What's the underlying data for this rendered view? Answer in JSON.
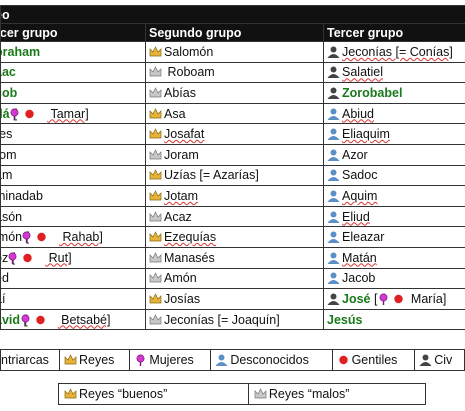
{
  "table": {
    "title": "eo",
    "headers": [
      "rcer grupo",
      "Segundo grupo",
      "Tercer grupo"
    ],
    "rows": [
      [
        {
          "t": "oraham",
          "k": "green"
        },
        {
          "t": "Salomón",
          "i": "crown-gold"
        },
        {
          "t": "Jeconías [= Conías]",
          "i": "person-dark",
          "u": true
        }
      ],
      [
        {
          "t": "aac",
          "k": "green"
        },
        {
          "t": " Roboam",
          "i": "crown-gray"
        },
        {
          "t": "Salatiel",
          "i": "person-dark",
          "u": true
        }
      ],
      [
        {
          "t": "cob",
          "k": "green"
        },
        {
          "t": "Abías",
          "i": "crown-gray"
        },
        {
          "t": "Zorobabel",
          "i": "person-dark",
          "k": "green"
        }
      ],
      [
        {
          "t": "dá [",
          "k": "green",
          "extra": " Tamar]"
        },
        {
          "t": "Asa",
          "i": "crown-gold"
        },
        {
          "t": "Abiud",
          "i": "person-blue",
          "u": true
        }
      ],
      [
        {
          "t": "res"
        },
        {
          "t": "Josafat",
          "i": "crown-gold",
          "u": true
        },
        {
          "t": "Eliaquim",
          "i": "person-blue",
          "u": true
        }
      ],
      [
        {
          "t": "rom"
        },
        {
          "t": "Joram",
          "i": "crown-gray"
        },
        {
          "t": "Azor",
          "i": "person-blue"
        }
      ],
      [
        {
          "t": "am"
        },
        {
          "t": "Uzías [= Azarías]",
          "i": "crown-gold"
        },
        {
          "t": "Sadoc",
          "i": "person-blue"
        }
      ],
      [
        {
          "t": "minadab"
        },
        {
          "t": "Jotam",
          "i": "crown-gold",
          "u": true
        },
        {
          "t": "Aquim",
          "i": "person-blue",
          "u": true
        }
      ],
      [
        {
          "t": "asón"
        },
        {
          "t": "Acaz",
          "i": "crown-gray"
        },
        {
          "t": "Eliud",
          "i": "person-blue",
          "u": true
        }
      ],
      [
        {
          "t": "lmón [",
          "extra": " Rahab]"
        },
        {
          "t": "Ezequías",
          "i": "crown-gold",
          "u": true
        },
        {
          "t": "Eleazar",
          "i": "person-blue"
        }
      ],
      [
        {
          "t": "oz [",
          "extra": " Rut]"
        },
        {
          "t": "Manasés",
          "i": "crown-gray"
        },
        {
          "t": "Matán",
          "i": "person-blue",
          "u": true
        }
      ],
      [
        {
          "t": "ed"
        },
        {
          "t": "Amón",
          "i": "crown-gray"
        },
        {
          "t": "Jacob",
          "i": "person-blue"
        }
      ],
      [
        {
          "t": "aí"
        },
        {
          "t": "Josías",
          "i": "crown-gold"
        },
        {
          "t": "José",
          "i": "person-dark",
          "k": "green",
          "extra": " María]"
        }
      ],
      [
        {
          "t": "avid [",
          "k": "green",
          "extra": " Betsabé]"
        },
        {
          "t": "Jeconías [= Joaquín]",
          "i": "crown-gray"
        },
        {
          "t": "Jesús",
          "i": "",
          "k": "green"
        }
      ]
    ]
  },
  "legend": [
    "ntriarcas",
    "Reyes",
    "Mujeres",
    "Desconocidos",
    "Gentiles",
    "Civ"
  ],
  "legend2": [
    "Reyes “buenos”",
    "Reyes “malos”"
  ],
  "colors": {
    "green": "#1a7a1a",
    "header": "#111111",
    "female": "#c020c0",
    "gentile": "#e02020",
    "unknown": "#5a8fc8"
  }
}
